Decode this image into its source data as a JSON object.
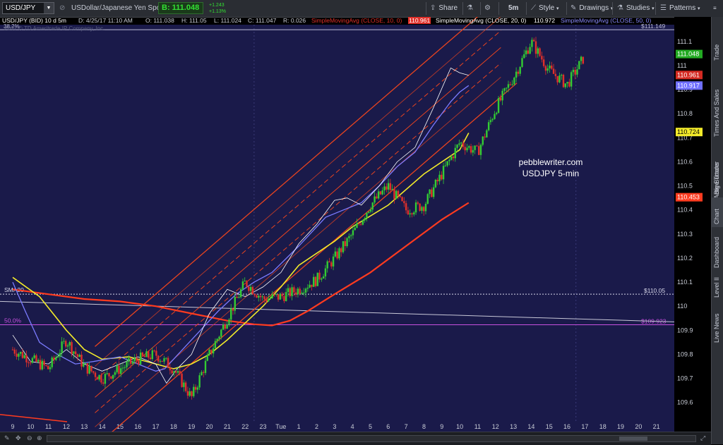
{
  "toolbar": {
    "symbol": "USD/JPY",
    "description": "USDollar/Japanese Yen Spot",
    "bid": "B: 111.048",
    "change_abs": "+1.243",
    "change_pct": "+1.13%",
    "buttons": {
      "share": "Share",
      "interval": "5m",
      "style": "Style",
      "drawings": "Drawings",
      "studies": "Studies",
      "patterns": "Patterns"
    }
  },
  "status": {
    "chart_title": "USD/JPY (BID) 10 d 5m",
    "date": "D: 4/25/17 11:10 AM",
    "open": "O: 111.038",
    "high": "H: 111.05",
    "low": "L: 111.024",
    "close": "C: 111.047",
    "range": "R: 0.026",
    "sma10": "SimpleMovingAvg (CLOSE, 10, 0)",
    "sma10_val": "110.961",
    "sma20": "SimpleMovingAvg (CLOSE, 20, 0)",
    "sma20_val": "110.972",
    "sma50": "SimpleMovingAvg (CLOSE, 50, 0)"
  },
  "watermark": "2017 © TD Ameritrade IP Company, Inc.",
  "sidebar_tabs": [
    "Trade",
    "Times And Sales",
    "Active Trader",
    "Big Buttons",
    "Chart",
    "Dashboard",
    "Level II",
    "Live News"
  ],
  "colors": {
    "background": "#1a1a4a",
    "candle_up": "#33cc33",
    "candle_down": "#e0302a",
    "sma10": "#ffffff",
    "sma20": "#7b7bff",
    "sma100": "#f2ea2a",
    "sma200": "#ff3b1f",
    "channel": "#e8431f",
    "fib": "#c850e0"
  },
  "chart_data": {
    "type": "candlestick",
    "title": "USD/JPY (BID) 10 d 5m",
    "ylim": [
      109.52,
      111.17
    ],
    "y_ticks": [
      109.6,
      109.7,
      109.8,
      109.9,
      110,
      110.1,
      110.2,
      110.3,
      110.4,
      110.5,
      110.6,
      110.7,
      110.8,
      110.9,
      111,
      111.1
    ],
    "x_labels": [
      "9",
      "10",
      "11",
      "12",
      "13",
      "14",
      "15",
      "16",
      "17",
      "18",
      "19",
      "20",
      "21",
      "22",
      "23",
      "Tue",
      "1",
      "2",
      "3",
      "4",
      "5",
      "6",
      "7",
      "8",
      "9",
      "10",
      "11",
      "12",
      "13",
      "14",
      "15",
      "16",
      "17",
      "18",
      "19",
      "20",
      "21"
    ],
    "price_path": [
      [
        0,
        109.82
      ],
      [
        1,
        109.78
      ],
      [
        2,
        109.74
      ],
      [
        3,
        109.86
      ],
      [
        4,
        109.75
      ],
      [
        5,
        109.7
      ],
      [
        6,
        109.74
      ],
      [
        7,
        109.78
      ],
      [
        8,
        109.8
      ],
      [
        9,
        109.74
      ],
      [
        10,
        109.62
      ],
      [
        11,
        109.8
      ],
      [
        12,
        109.95
      ],
      [
        13,
        110.1
      ],
      [
        14,
        110.03
      ],
      [
        15,
        110.04
      ],
      [
        16,
        110.07
      ],
      [
        17,
        110.11
      ],
      [
        18,
        110.2
      ],
      [
        19,
        110.3
      ],
      [
        20,
        110.42
      ],
      [
        21,
        110.5
      ],
      [
        22,
        110.4
      ],
      [
        23,
        110.42
      ],
      [
        24,
        110.55
      ],
      [
        25,
        110.68
      ],
      [
        26,
        110.64
      ],
      [
        27,
        110.82
      ],
      [
        28,
        110.95
      ],
      [
        29,
        111.1
      ],
      [
        30,
        110.98
      ],
      [
        31,
        110.92
      ],
      [
        32,
        111.04
      ]
    ],
    "series": [
      {
        "name": "SimpleMovingAvg (CLOSE, 10, 0)",
        "last": "110.961"
      },
      {
        "name": "SimpleMovingAvg (CLOSE, 20, 0)",
        "last": "110.972"
      },
      {
        "name": "SimpleMovingAvg (CLOSE, 50, 0)",
        "last": "110.917"
      },
      {
        "last": "110.724"
      },
      {
        "last": "110.453"
      }
    ],
    "last_price": "111.048",
    "sma10_label": "110.961",
    "sma50_label": "110.917",
    "sma100_label": "110.724",
    "sma200_label": "110.453",
    "fib": [
      {
        "label": "38.2%",
        "value": 111.149,
        "price_label": "$111.149"
      },
      {
        "label": "50.0%",
        "value": 109.923,
        "price_label": "$109.923"
      }
    ],
    "sma20_line": {
      "label": "SMA20",
      "value": 110.05,
      "price_label": "$110.05"
    },
    "annotation": [
      "pebblewriter.com",
      "USDJPY 5-min"
    ]
  }
}
